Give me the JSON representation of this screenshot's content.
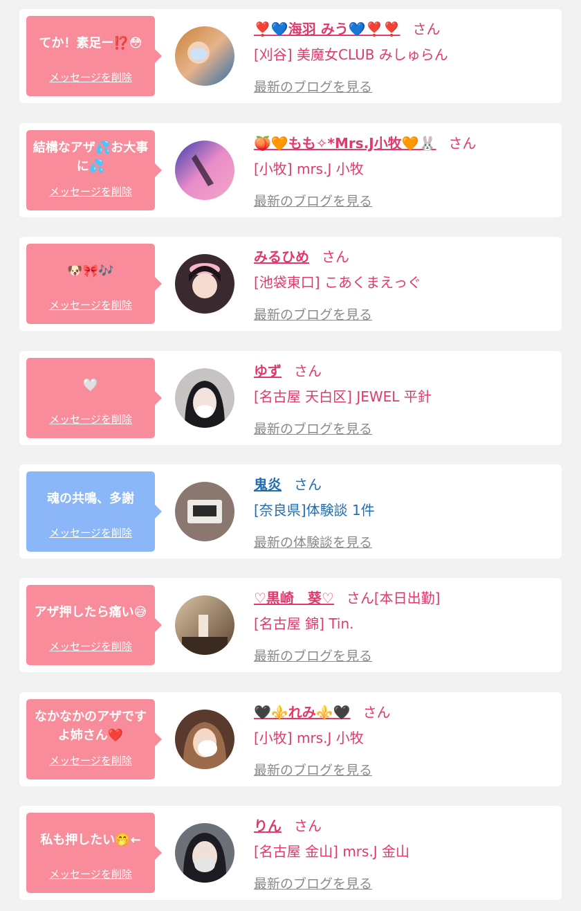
{
  "entries": [
    {
      "message": "てか！素足ー⁉️😳",
      "delete_label": "メッセージを削除",
      "name": "❣️💙海羽 みう💙❣️❣️",
      "honorific": "さん",
      "shop": "[刈谷] 美魔女CLUB みしゅらん",
      "blog_link": "最新のブログを見る",
      "theme": "pink",
      "avatar": "avatar-photo-1"
    },
    {
      "message": "結構なアザ💦お大事に💦",
      "delete_label": "メッセージを削除",
      "name": "🍑🧡もも✧*Mrs.J小牧🧡🐰",
      "honorific": "さん",
      "shop": "[小牧] mrs.J 小牧",
      "blog_link": "最新のブログを見る",
      "theme": "pink",
      "avatar": "avatar-photo-2"
    },
    {
      "message": "🐶🎀🎶",
      "delete_label": "メッセージを削除",
      "name": "みるひめ",
      "honorific": "さん",
      "shop": "[池袋東口] こあくまえっぐ",
      "blog_link": "最新のブログを見る",
      "theme": "pink",
      "avatar": "avatar-photo-3"
    },
    {
      "message": "🤍",
      "delete_label": "メッセージを削除",
      "name": "ゆず",
      "honorific": "さん",
      "shop": "[名古屋 天白区] JEWEL 平針",
      "blog_link": "最新のブログを見る",
      "theme": "pink",
      "avatar": "avatar-photo-4"
    },
    {
      "message": "魂の共鳴、多謝",
      "delete_label": "メッセージを削除",
      "name": "鬼炎",
      "honorific": "さん",
      "shop": "[奈良県]体験談 1件",
      "blog_link": "最新の体験談を見る",
      "theme": "blue",
      "avatar": "avatar-clock-photo"
    },
    {
      "message": "アザ押したら痛い😅",
      "delete_label": "メッセージを削除",
      "name": "♡黒崎　葵♡",
      "honorific": "さん[本日出勤]",
      "shop": "[名古屋 錦] Tin.",
      "blog_link": "最新のブログを見る",
      "theme": "pink",
      "avatar": "avatar-photo-6"
    },
    {
      "message": "なかなかのアザですよ姉さん❤️",
      "delete_label": "メッセージを削除",
      "name": "🖤⚜️れみ⚜️🖤",
      "honorific": "さん",
      "shop": "[小牧] mrs.J 小牧",
      "blog_link": "最新のブログを見る",
      "theme": "pink",
      "avatar": "avatar-photo-7"
    },
    {
      "message": "私も押したい🤭←",
      "delete_label": "メッセージを削除",
      "name": "りん",
      "honorific": "さん",
      "shop": "[名古屋 金山] mrs.J 金山",
      "blog_link": "最新のブログを見る",
      "theme": "pink",
      "avatar": "avatar-photo-8"
    }
  ],
  "colors": {
    "bubble_pink": "#f98c9a",
    "bubble_blue": "#8bb6f7",
    "text_pink": "#e2386a",
    "text_blue": "#1e6db5",
    "link_gray": "#8a8a8a",
    "background": "#f2f2f2"
  }
}
